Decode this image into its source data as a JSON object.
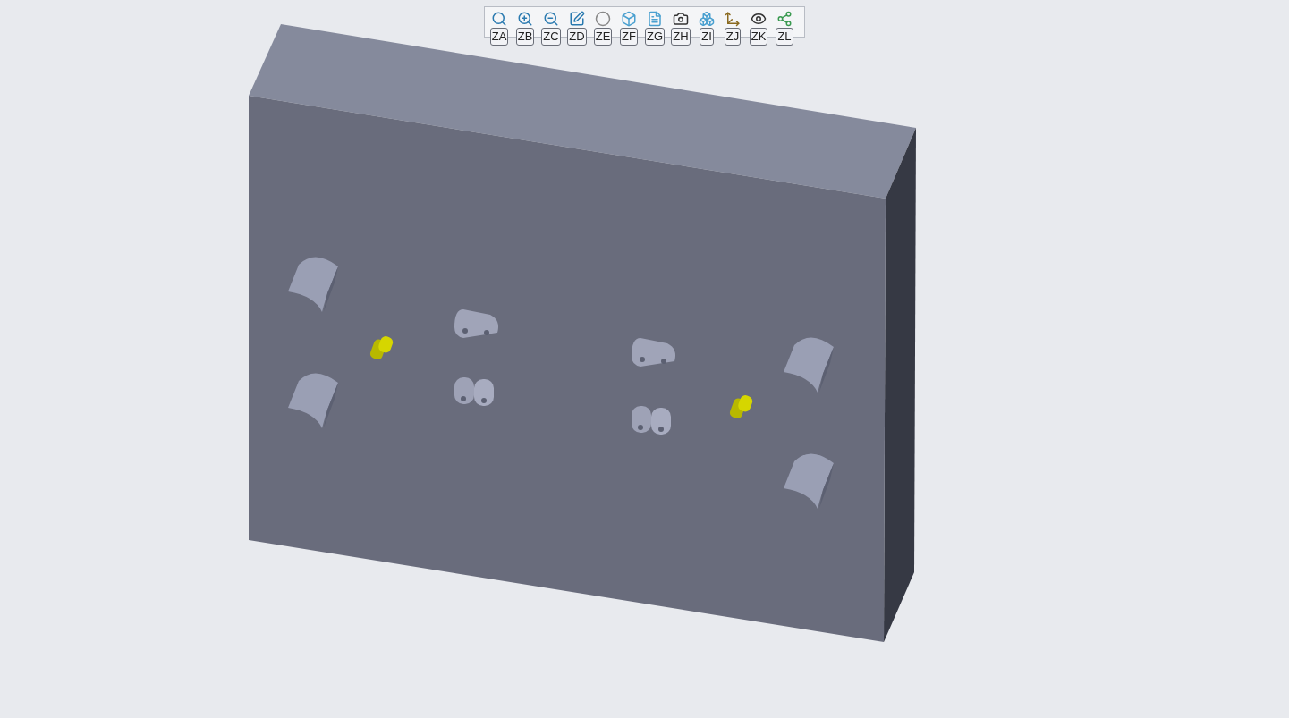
{
  "toolbar": {
    "buttons": [
      {
        "keytip": "ZA"
      },
      {
        "keytip": "ZB"
      },
      {
        "keytip": "ZC"
      },
      {
        "keytip": "ZD"
      },
      {
        "keytip": "ZE"
      },
      {
        "keytip": "ZF"
      },
      {
        "keytip": "ZG"
      },
      {
        "keytip": "ZH"
      },
      {
        "keytip": "ZI"
      },
      {
        "keytip": "ZJ"
      },
      {
        "keytip": "ZK"
      },
      {
        "keytip": "ZL"
      }
    ]
  }
}
